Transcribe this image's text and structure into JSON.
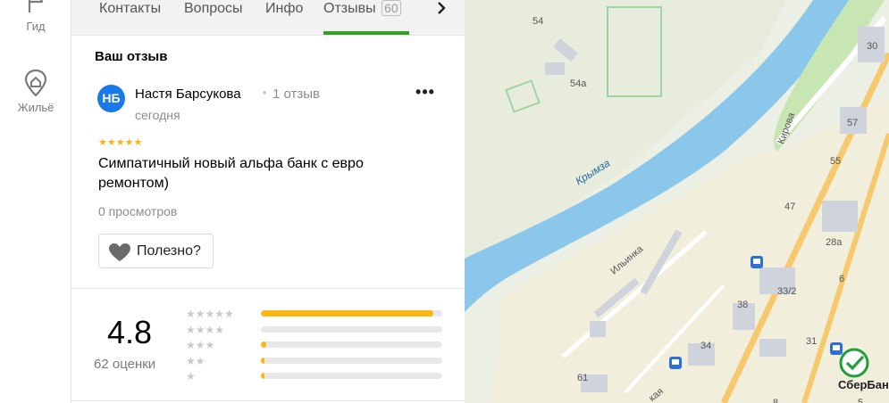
{
  "rail": {
    "items": [
      {
        "label": "Гид",
        "icon": "flag-icon"
      },
      {
        "label": "Жильё",
        "icon": "house-pin-icon"
      }
    ]
  },
  "tabs": {
    "items": [
      {
        "label": "Контакты"
      },
      {
        "label": "Вопросы"
      },
      {
        "label": "Инфо"
      },
      {
        "label": "Отзывы",
        "count": "60",
        "active": true
      }
    ],
    "next_icon": "chevron-right-icon"
  },
  "review": {
    "section_title": "Ваш отзыв",
    "avatar_initials": "НБ",
    "author": "Настя Барсукова",
    "author_reviews": "1 отзыв",
    "date": "сегодня",
    "more": "•••",
    "stars": "★★★★★",
    "rating": 5,
    "text": "Симпатичный новый альфа банк с евро ремонтом)",
    "views": "0 просмотров",
    "useful_label": "Полезно?"
  },
  "summary": {
    "rating": "4.8",
    "ratings_count": "62 оценки",
    "distribution": [
      {
        "stars": "★★★★★",
        "share": 0.95
      },
      {
        "stars": "★★★★",
        "share": 0.0
      },
      {
        "stars": "★★★",
        "share": 0.03
      },
      {
        "stars": "★★",
        "share": 0.02
      },
      {
        "stars": "★",
        "share": 0.02
      }
    ]
  },
  "map": {
    "labels": {
      "river": "Крымза",
      "street_kirova": "Кирова",
      "street_ilyinka": "Ильинка",
      "street_partial": "кая",
      "houses": [
        "54",
        "54а",
        "30",
        "57",
        "55",
        "47",
        "28а",
        "33/2",
        "6",
        "38",
        "31",
        "34",
        "61",
        "8",
        "5"
      ]
    },
    "brand": "СберБанк",
    "colors": {
      "river": "#8ac7ea",
      "ground": "#ecefe3",
      "park": "#c8e6b4",
      "road": "#f7c96e"
    }
  },
  "colors": {
    "accent": "#2ea31f",
    "avatar": "#1a79e8",
    "star": "#fcb21b"
  }
}
